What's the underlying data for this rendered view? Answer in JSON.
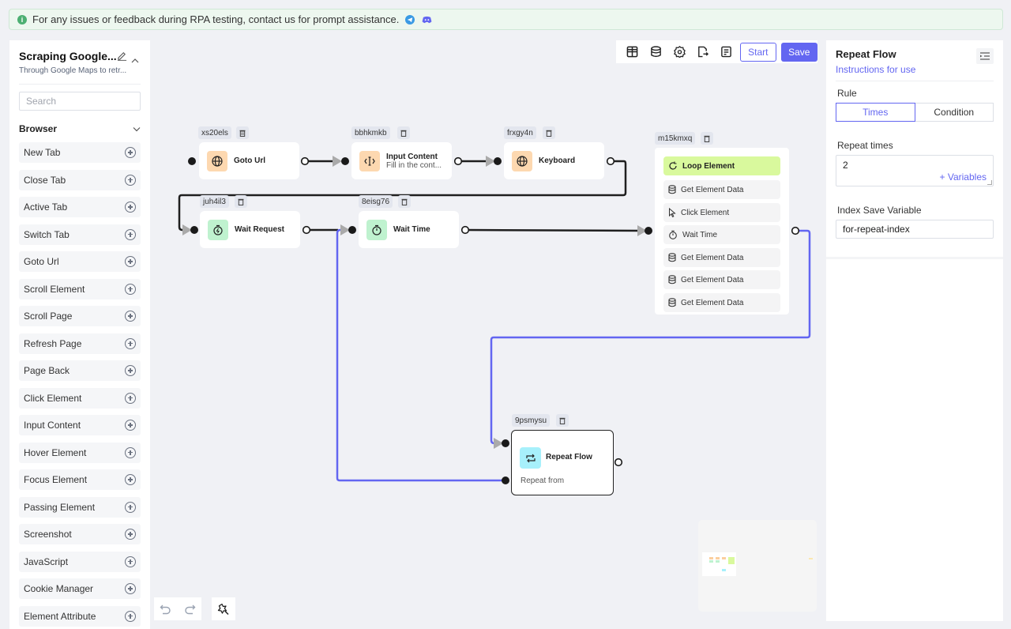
{
  "banner": {
    "text": "For any issues or feedback during RPA testing, contact us for prompt assistance.",
    "icons": [
      "info-icon",
      "telegram-icon",
      "discord-icon"
    ]
  },
  "left_panel": {
    "title": "Scraping Google...",
    "subtitle": "Through Google Maps to retr...",
    "search_placeholder": "Search",
    "group_label": "Browser",
    "items": [
      {
        "label": "New Tab"
      },
      {
        "label": "Close Tab"
      },
      {
        "label": "Active Tab"
      },
      {
        "label": "Switch Tab"
      },
      {
        "label": "Goto Url"
      },
      {
        "label": "Scroll Element"
      },
      {
        "label": "Scroll Page"
      },
      {
        "label": "Refresh Page"
      },
      {
        "label": "Page Back"
      },
      {
        "label": "Click Element"
      },
      {
        "label": "Input Content"
      },
      {
        "label": "Hover Element"
      },
      {
        "label": "Focus Element"
      },
      {
        "label": "Passing Element"
      },
      {
        "label": "Screenshot"
      },
      {
        "label": "JavaScript"
      },
      {
        "label": "Cookie Manager"
      },
      {
        "label": "Element Attribute"
      }
    ]
  },
  "toolbar": {
    "icons": [
      "table-icon",
      "database-icon",
      "settings-icon",
      "export-icon",
      "log-icon"
    ],
    "start_label": "Start",
    "save_label": "Save"
  },
  "right_panel": {
    "title": "Repeat Flow",
    "instructions_link": "Instructions for use",
    "rule_label": "Rule",
    "rule_options": [
      "Times",
      "Condition"
    ],
    "rule_selected": "Times",
    "repeat_times_label": "Repeat times",
    "repeat_times_value": "2",
    "variables_link": "+ Variables",
    "index_label": "Index Save Variable",
    "index_value": "for-repeat-index"
  },
  "nodes": {
    "goto_url": {
      "id": "xs20els",
      "title": "Goto Url",
      "icon": "globe-icon"
    },
    "input_content": {
      "id": "bbhkmkb",
      "title": "Input Content",
      "subtitle": "Fill in the cont...",
      "icon": "text-cursor-icon"
    },
    "keyboard": {
      "id": "frxgy4n",
      "title": "Keyboard",
      "icon": "globe-icon"
    },
    "wait_request": {
      "id": "juh4il3",
      "title": "Wait Request",
      "icon": "stopwatch-bolt-icon"
    },
    "wait_time": {
      "id": "8eisg76",
      "title": "Wait Time",
      "icon": "stopwatch-icon"
    },
    "loop_group": {
      "id": "m15kmxq",
      "items": [
        {
          "label": "Loop Element",
          "icon": "loop-icon"
        },
        {
          "label": "Get Element Data",
          "icon": "database-icon"
        },
        {
          "label": "Click Element",
          "icon": "cursor-icon"
        },
        {
          "label": "Wait Time",
          "icon": "stopwatch-icon"
        },
        {
          "label": "Get Element Data",
          "icon": "database-icon"
        },
        {
          "label": "Get Element Data",
          "icon": "database-icon"
        },
        {
          "label": "Get Element Data",
          "icon": "database-icon"
        }
      ]
    },
    "repeat_flow": {
      "id": "9psmysu",
      "title": "Repeat Flow",
      "subtitle": "Repeat from",
      "icon": "repeat-icon"
    }
  },
  "colors": {
    "accent": "#6366f1",
    "edge": "#1f1f1f",
    "loop_highlight": "#d9f99d"
  }
}
